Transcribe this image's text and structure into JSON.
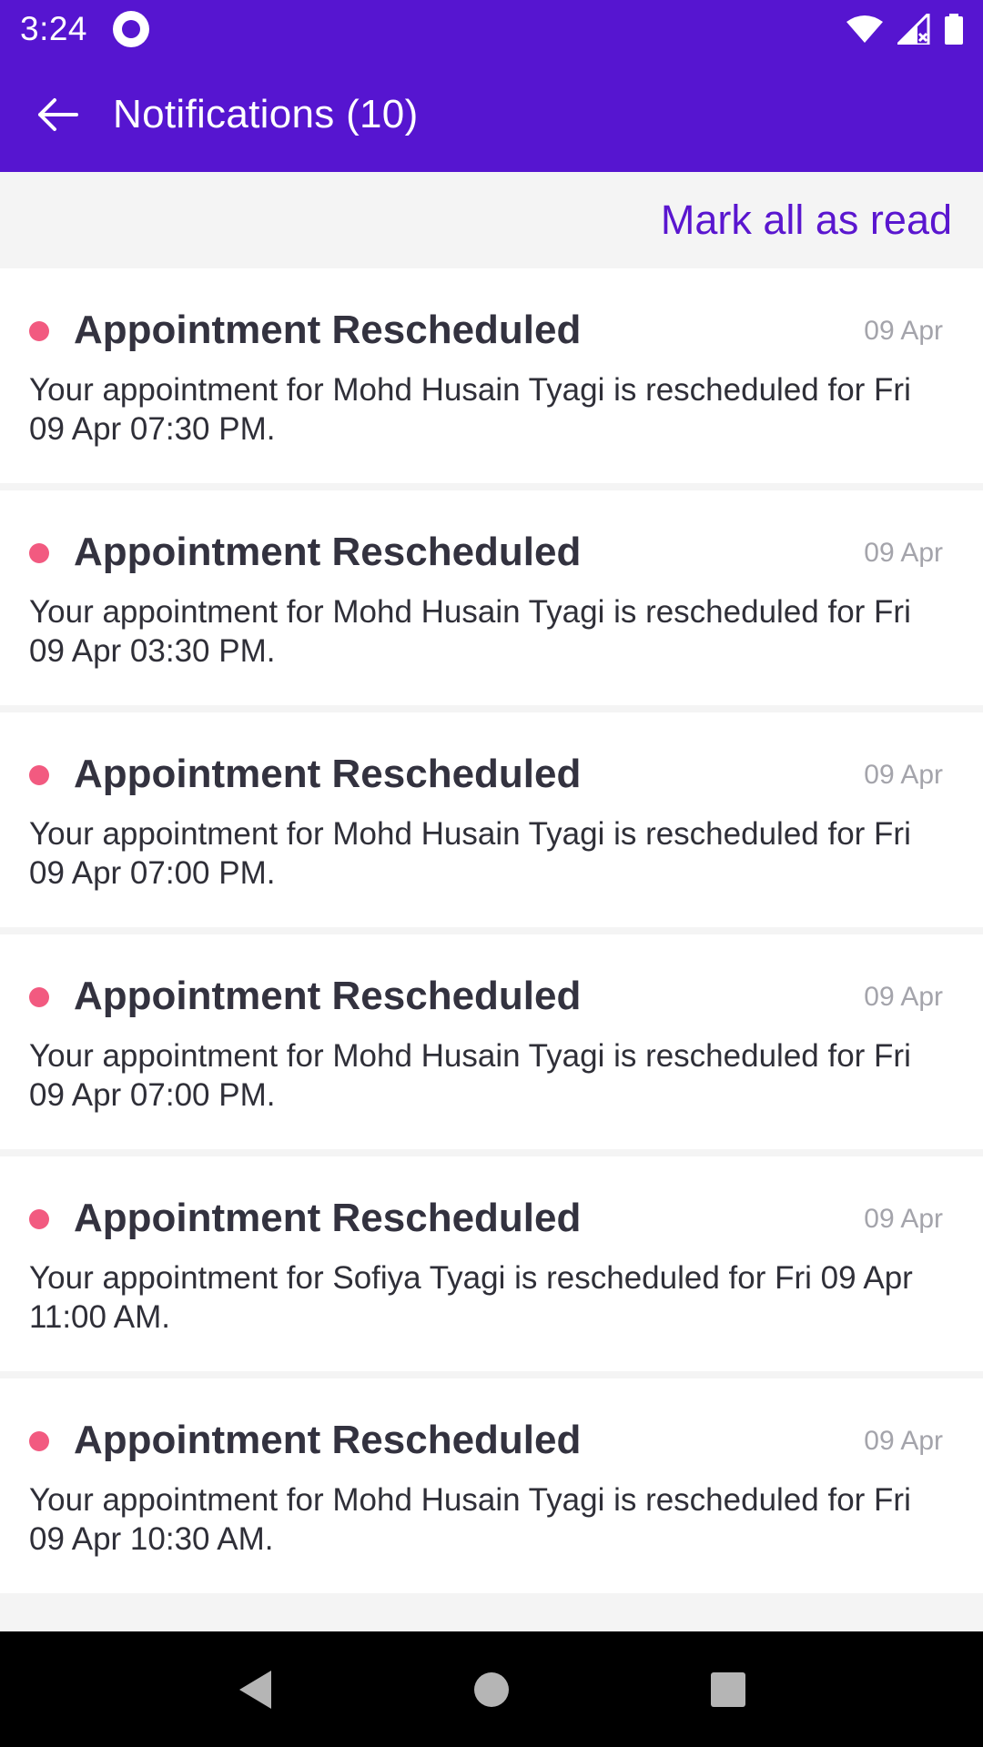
{
  "status_bar": {
    "time": "3:24",
    "icons": [
      "app-sync-icon",
      "wifi-icon",
      "signal-icon",
      "battery-icon"
    ]
  },
  "app_bar": {
    "back_icon": "arrow-left-icon",
    "title": "Notifications (10)"
  },
  "actions": {
    "mark_all_label": "Mark all as read"
  },
  "notifications": [
    {
      "title": "Appointment Rescheduled",
      "date": "09 Apr",
      "message": "Your appointment for Mohd Husain Tyagi is rescheduled for Fri 09 Apr 07:30 PM.",
      "unread": true
    },
    {
      "title": "Appointment Rescheduled",
      "date": "09 Apr",
      "message": "Your appointment for Mohd Husain Tyagi is rescheduled for Fri 09 Apr 03:30 PM.",
      "unread": true
    },
    {
      "title": "Appointment Rescheduled",
      "date": "09 Apr",
      "message": "Your appointment for Mohd Husain Tyagi is rescheduled for Fri 09 Apr 07:00 PM.",
      "unread": true
    },
    {
      "title": "Appointment Rescheduled",
      "date": "09 Apr",
      "message": "Your appointment for Mohd Husain Tyagi is rescheduled for Fri 09 Apr 07:00 PM.",
      "unread": true
    },
    {
      "title": "Appointment Rescheduled",
      "date": "09 Apr",
      "message": "Your appointment for Sofiya Tyagi is rescheduled for Fri 09 Apr 11:00 AM.",
      "unread": true
    },
    {
      "title": "Appointment Rescheduled",
      "date": "09 Apr",
      "message": "Your appointment for Mohd Husain Tyagi is rescheduled for Fri 09 Apr 10:30 AM.",
      "unread": true
    }
  ],
  "nav_bar": {
    "icons": [
      "nav-back-icon",
      "nav-home-icon",
      "nav-recents-icon"
    ]
  },
  "colors": {
    "primary": "#5615d0",
    "accent_text": "#5a16cf",
    "unread_dot": "#f25a80",
    "background": "#f4f4f4"
  }
}
